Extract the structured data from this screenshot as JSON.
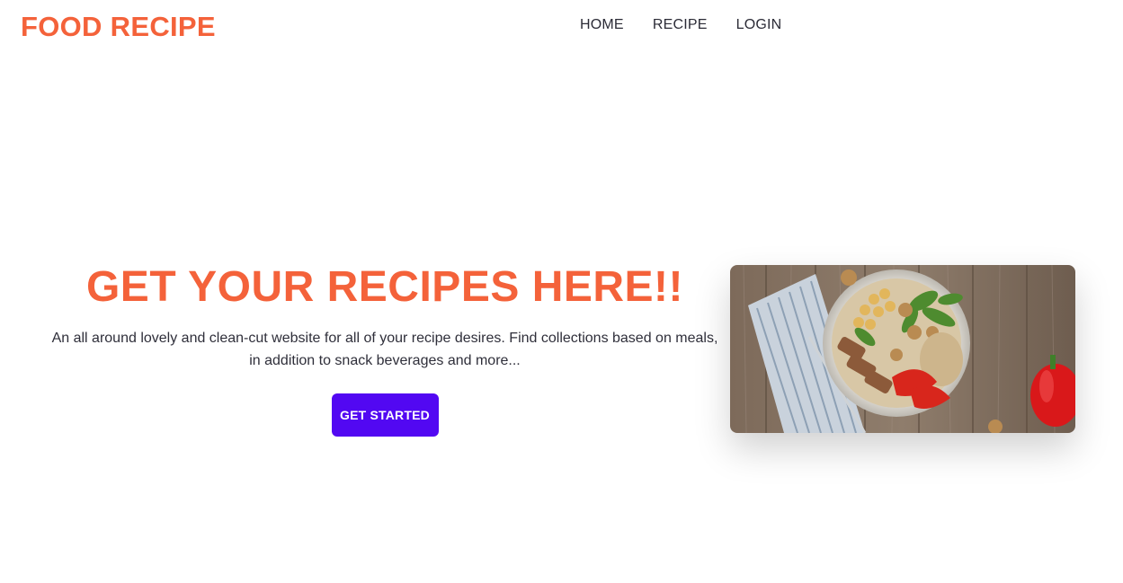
{
  "brand": {
    "name": "FOOD RECIPE",
    "color": "#f4623a"
  },
  "nav": {
    "items": [
      {
        "label": "HOME"
      },
      {
        "label": "RECIPE"
      },
      {
        "label": "LOGIN"
      }
    ]
  },
  "hero": {
    "title": "GET YOUR RECIPES HERE!!",
    "description": "An all around lovely and clean-cut website for all of your recipe desires. Find collections based on meals, in addition to snack beverages and more...",
    "cta_label": "GET STARTED",
    "cta_color": "#5208f2",
    "image": {
      "subject": "salad bowl with chicken, chickpeas, walnuts and red peppers on wooden table"
    }
  }
}
